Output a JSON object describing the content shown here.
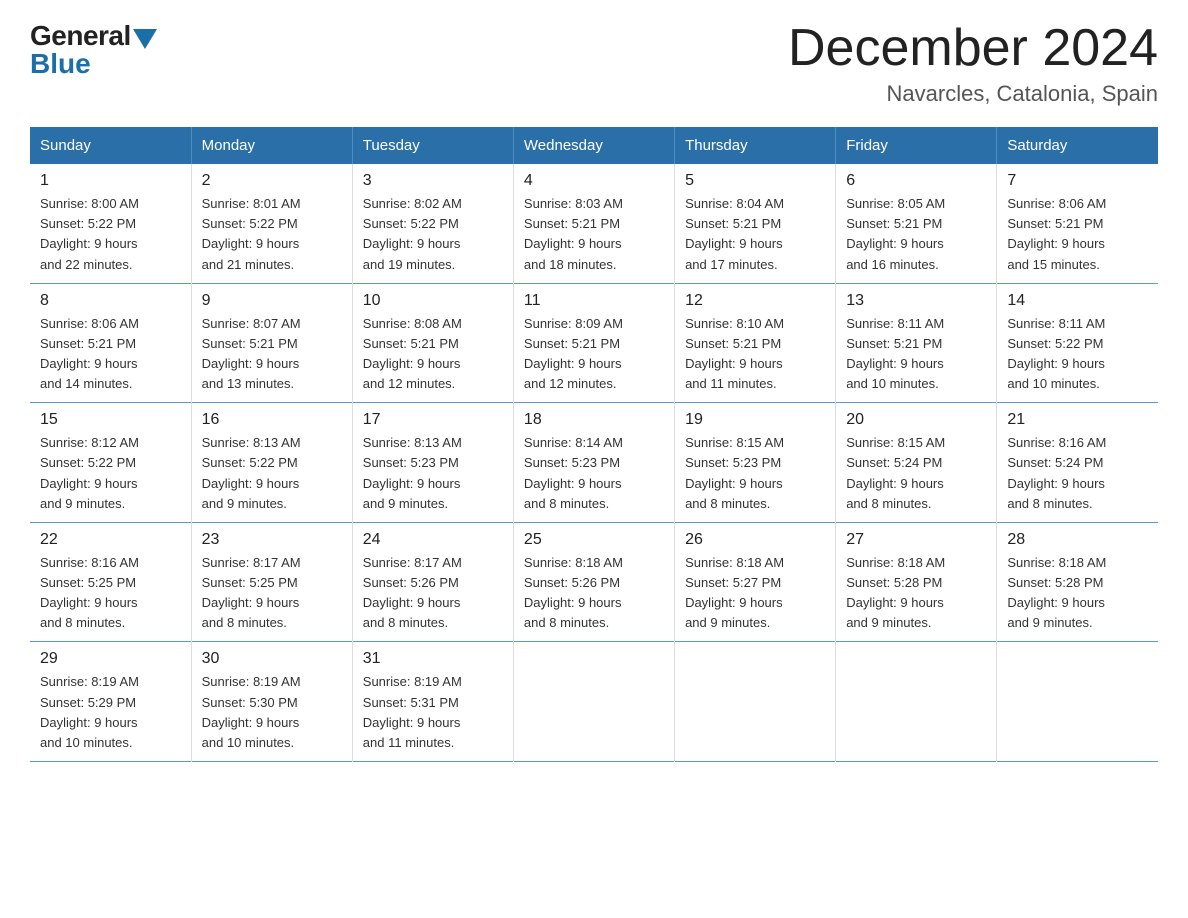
{
  "logo": {
    "general": "General",
    "blue": "Blue"
  },
  "title": {
    "month_year": "December 2024",
    "location": "Navarcles, Catalonia, Spain"
  },
  "days_of_week": [
    "Sunday",
    "Monday",
    "Tuesday",
    "Wednesday",
    "Thursday",
    "Friday",
    "Saturday"
  ],
  "weeks": [
    [
      {
        "day": "1",
        "sunrise": "8:00 AM",
        "sunset": "5:22 PM",
        "daylight": "9 hours and 22 minutes."
      },
      {
        "day": "2",
        "sunrise": "8:01 AM",
        "sunset": "5:22 PM",
        "daylight": "9 hours and 21 minutes."
      },
      {
        "day": "3",
        "sunrise": "8:02 AM",
        "sunset": "5:22 PM",
        "daylight": "9 hours and 19 minutes."
      },
      {
        "day": "4",
        "sunrise": "8:03 AM",
        "sunset": "5:21 PM",
        "daylight": "9 hours and 18 minutes."
      },
      {
        "day": "5",
        "sunrise": "8:04 AM",
        "sunset": "5:21 PM",
        "daylight": "9 hours and 17 minutes."
      },
      {
        "day": "6",
        "sunrise": "8:05 AM",
        "sunset": "5:21 PM",
        "daylight": "9 hours and 16 minutes."
      },
      {
        "day": "7",
        "sunrise": "8:06 AM",
        "sunset": "5:21 PM",
        "daylight": "9 hours and 15 minutes."
      }
    ],
    [
      {
        "day": "8",
        "sunrise": "8:06 AM",
        "sunset": "5:21 PM",
        "daylight": "9 hours and 14 minutes."
      },
      {
        "day": "9",
        "sunrise": "8:07 AM",
        "sunset": "5:21 PM",
        "daylight": "9 hours and 13 minutes."
      },
      {
        "day": "10",
        "sunrise": "8:08 AM",
        "sunset": "5:21 PM",
        "daylight": "9 hours and 12 minutes."
      },
      {
        "day": "11",
        "sunrise": "8:09 AM",
        "sunset": "5:21 PM",
        "daylight": "9 hours and 12 minutes."
      },
      {
        "day": "12",
        "sunrise": "8:10 AM",
        "sunset": "5:21 PM",
        "daylight": "9 hours and 11 minutes."
      },
      {
        "day": "13",
        "sunrise": "8:11 AM",
        "sunset": "5:21 PM",
        "daylight": "9 hours and 10 minutes."
      },
      {
        "day": "14",
        "sunrise": "8:11 AM",
        "sunset": "5:22 PM",
        "daylight": "9 hours and 10 minutes."
      }
    ],
    [
      {
        "day": "15",
        "sunrise": "8:12 AM",
        "sunset": "5:22 PM",
        "daylight": "9 hours and 9 minutes."
      },
      {
        "day": "16",
        "sunrise": "8:13 AM",
        "sunset": "5:22 PM",
        "daylight": "9 hours and 9 minutes."
      },
      {
        "day": "17",
        "sunrise": "8:13 AM",
        "sunset": "5:23 PM",
        "daylight": "9 hours and 9 minutes."
      },
      {
        "day": "18",
        "sunrise": "8:14 AM",
        "sunset": "5:23 PM",
        "daylight": "9 hours and 8 minutes."
      },
      {
        "day": "19",
        "sunrise": "8:15 AM",
        "sunset": "5:23 PM",
        "daylight": "9 hours and 8 minutes."
      },
      {
        "day": "20",
        "sunrise": "8:15 AM",
        "sunset": "5:24 PM",
        "daylight": "9 hours and 8 minutes."
      },
      {
        "day": "21",
        "sunrise": "8:16 AM",
        "sunset": "5:24 PM",
        "daylight": "9 hours and 8 minutes."
      }
    ],
    [
      {
        "day": "22",
        "sunrise": "8:16 AM",
        "sunset": "5:25 PM",
        "daylight": "9 hours and 8 minutes."
      },
      {
        "day": "23",
        "sunrise": "8:17 AM",
        "sunset": "5:25 PM",
        "daylight": "9 hours and 8 minutes."
      },
      {
        "day": "24",
        "sunrise": "8:17 AM",
        "sunset": "5:26 PM",
        "daylight": "9 hours and 8 minutes."
      },
      {
        "day": "25",
        "sunrise": "8:18 AM",
        "sunset": "5:26 PM",
        "daylight": "9 hours and 8 minutes."
      },
      {
        "day": "26",
        "sunrise": "8:18 AM",
        "sunset": "5:27 PM",
        "daylight": "9 hours and 9 minutes."
      },
      {
        "day": "27",
        "sunrise": "8:18 AM",
        "sunset": "5:28 PM",
        "daylight": "9 hours and 9 minutes."
      },
      {
        "day": "28",
        "sunrise": "8:18 AM",
        "sunset": "5:28 PM",
        "daylight": "9 hours and 9 minutes."
      }
    ],
    [
      {
        "day": "29",
        "sunrise": "8:19 AM",
        "sunset": "5:29 PM",
        "daylight": "9 hours and 10 minutes."
      },
      {
        "day": "30",
        "sunrise": "8:19 AM",
        "sunset": "5:30 PM",
        "daylight": "9 hours and 10 minutes."
      },
      {
        "day": "31",
        "sunrise": "8:19 AM",
        "sunset": "5:31 PM",
        "daylight": "9 hours and 11 minutes."
      },
      null,
      null,
      null,
      null
    ]
  ],
  "labels": {
    "sunrise": "Sunrise:",
    "sunset": "Sunset:",
    "daylight": "Daylight:"
  }
}
